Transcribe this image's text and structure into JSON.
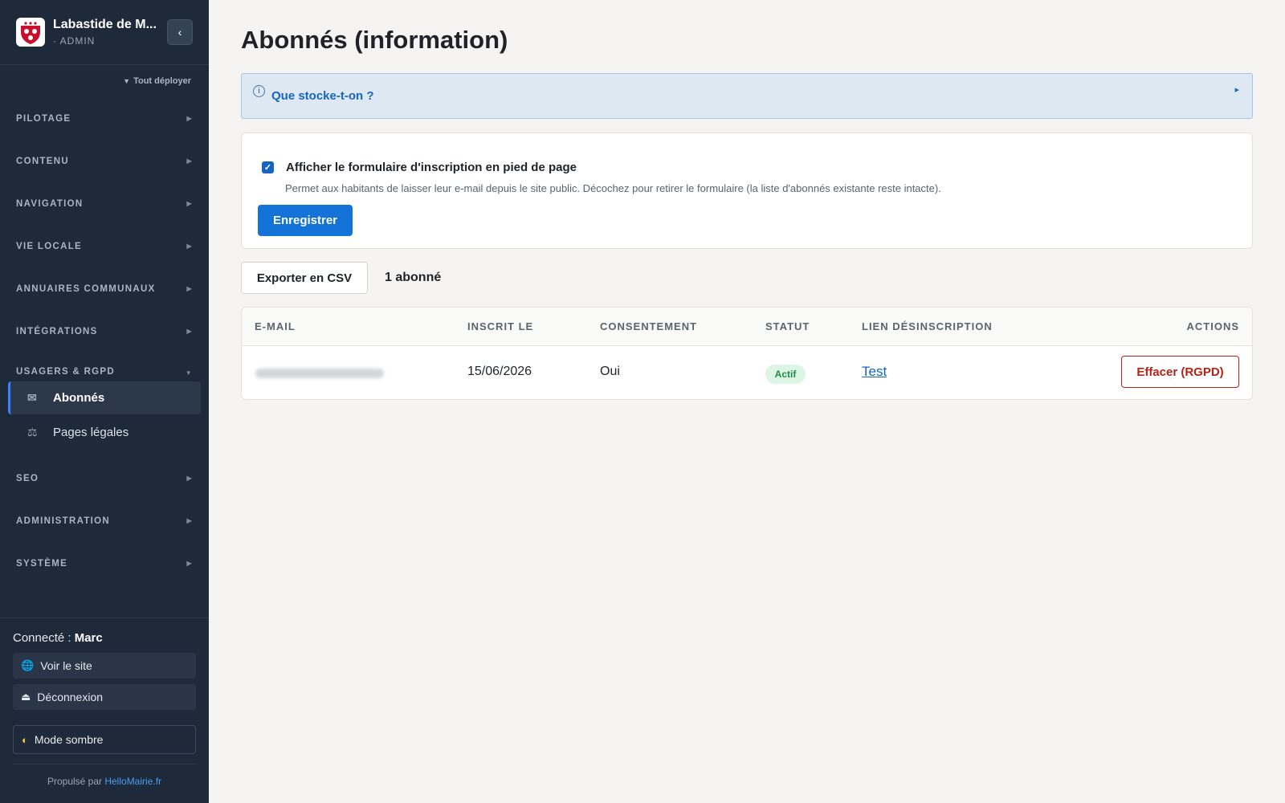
{
  "brand": {
    "name": "Labastide de M...",
    "subtitle": "· ADMIN",
    "collapse_icon": "chevron-left-icon"
  },
  "sidebar": {
    "expand_all": "Tout déployer",
    "sections": [
      {
        "label": "PILOTAGE"
      },
      {
        "label": "CONTENU"
      },
      {
        "label": "NAVIGATION"
      },
      {
        "label": "VIE LOCALE"
      },
      {
        "label": "ANNUAIRES COMMUNAUX"
      },
      {
        "label": "INTÉGRATIONS"
      },
      {
        "label": "USAGERS & RGPD"
      },
      {
        "label": "SEO"
      },
      {
        "label": "ADMINISTRATION"
      },
      {
        "label": "SYSTÈME"
      }
    ],
    "sub_items": [
      {
        "label": "Abonnés",
        "icon": "envelope-icon",
        "active": true
      },
      {
        "label": "Pages légales",
        "icon": "scale-icon",
        "active": false
      }
    ],
    "accent_color": "#3b82f6"
  },
  "footer": {
    "connected_prefix": "Connecté : ",
    "user": "Marc",
    "view_site": "Voir le site",
    "logout": "Déconnexion",
    "dark_mode": "Mode sombre",
    "powered_prefix": "Propulsé par ",
    "powered_link": "HelloMairie.fr"
  },
  "page": {
    "title": "Abonnés (information)",
    "info_label": "Que stocke-t-on ?",
    "checkbox_label": "Afficher le formulaire d'inscription en pied de page",
    "checkbox_checked": true,
    "checkbox_help": "Permet aux habitants de laisser leur e-mail depuis le site public. Décochez pour retirer le formulaire (la liste d'abonnés existante reste intacte).",
    "save_label": "Enregistrer",
    "export_label": "Exporter en CSV",
    "count_label": "1 abonné"
  },
  "table": {
    "headers": [
      "E-MAIL",
      "INSCRIT LE",
      "CONSENTEMENT",
      "STATUT",
      "LIEN DÉSINSCRIPTION",
      "ACTIONS"
    ],
    "rows": [
      {
        "date": "15/06/2026",
        "consent": "Oui",
        "status": "Actif",
        "unsub_link": "Test",
        "action": "Effacer (RGPD)"
      }
    ]
  }
}
